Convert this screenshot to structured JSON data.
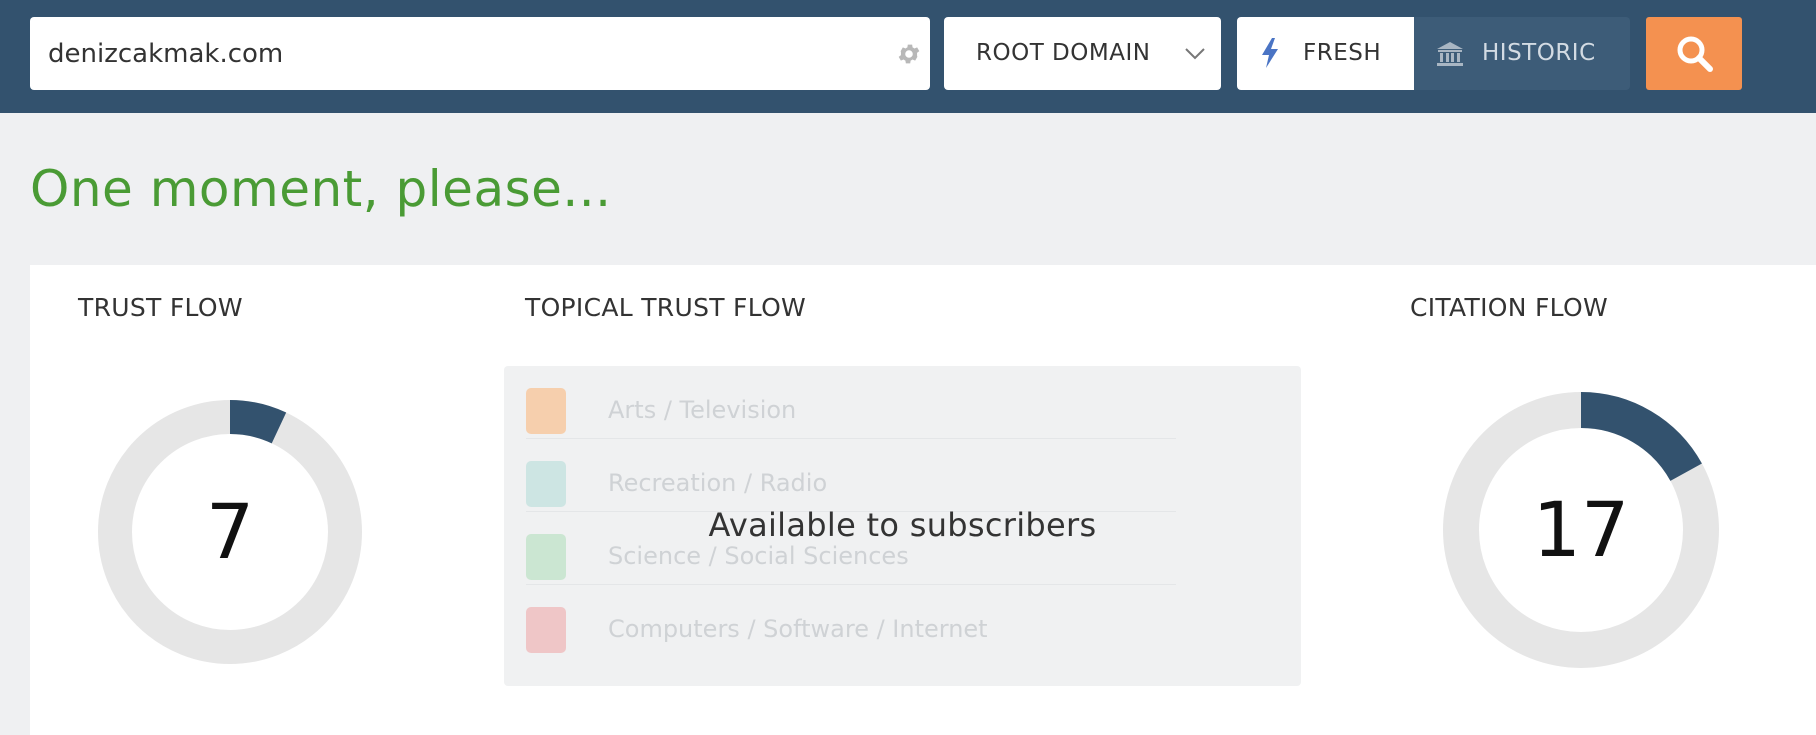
{
  "search": {
    "value": "denizcakmak.com",
    "gear_icon": "gear-icon"
  },
  "scope": {
    "selected": "ROOT DOMAIN",
    "icon": "chevron-down-icon"
  },
  "index_toggle": {
    "fresh_label": "FRESH",
    "fresh_icon": "lightning-bolt-icon",
    "historic_label": "HISTORIC",
    "historic_icon": "bank-icon",
    "selected": "FRESH"
  },
  "search_button": {
    "icon": "search-icon",
    "color": "#f49150"
  },
  "page": {
    "heading": "One moment, please...",
    "heading_color": "#4a9b35"
  },
  "metrics": {
    "trust_flow": {
      "title": "TRUST FLOW",
      "value": "7",
      "fraction": 0.07
    },
    "topical_trust_flow": {
      "title": "TOPICAL TRUST FLOW",
      "overlay": "Available to subscribers",
      "topics": [
        {
          "label": "Arts / Television",
          "color": "#f6cfad"
        },
        {
          "label": "Recreation / Radio",
          "color": "#cde5e3"
        },
        {
          "label": "Science / Social Sciences",
          "color": "#cbe6d2"
        },
        {
          "label": "Computers / Software / Internet",
          "color": "#efc6c7"
        }
      ]
    },
    "citation_flow": {
      "title": "CITATION FLOW",
      "value": "17",
      "fraction": 0.17
    }
  },
  "colors": {
    "topbar": "#33526e",
    "donut_fill": "#33526e",
    "donut_track": "#e6e6e6"
  }
}
